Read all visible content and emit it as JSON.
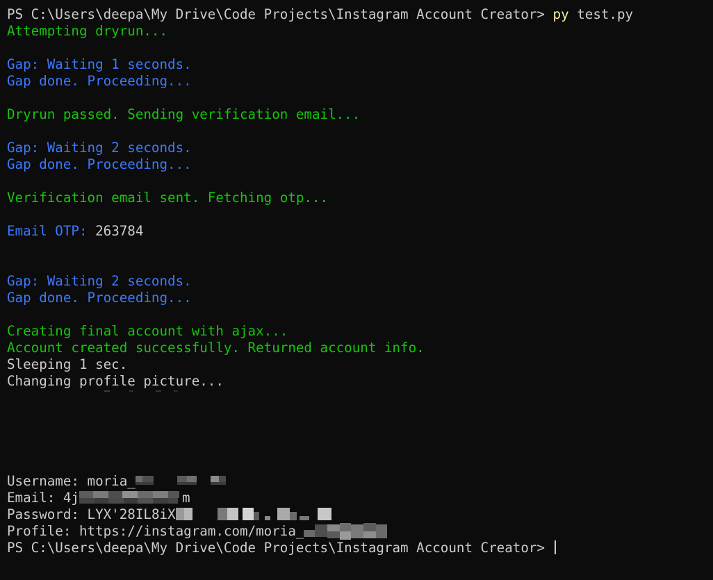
{
  "terminal": {
    "prompt": "PS C:\\Users\\deepa\\My Drive\\Code Projects\\Instagram Account Creator>",
    "command_exe": "py",
    "command_args": "test.py",
    "lines": {
      "l1": "Attempting dryrun...",
      "l2": "Gap: Waiting 1 seconds.",
      "l3": "Gap done. Proceeding...",
      "l4": "Dryrun passed. Sending verification email...",
      "l5": "Gap: Waiting 2 seconds.",
      "l6": "Gap done. Proceeding...",
      "l7": "Verification email sent. Fetching otp...",
      "l8_label": "Email OTP:",
      "l8_value": "263784",
      "l9": "Gap: Waiting 2 seconds.",
      "l10": "Gap done. Proceeding...",
      "l11": "Creating final account with ajax...",
      "l12": "Account created successfully. Returned account info.",
      "l13": "Sleeping 1 sec.",
      "l14": "Changing profile picture..."
    },
    "account": {
      "username_label": "Username:",
      "username_value": "moria_",
      "email_label": "Email:",
      "email_value": "4j",
      "email_tail": "m",
      "password_label": "Password:",
      "password_value": "LYX'28IL8iX",
      "profile_label": "Profile:",
      "profile_value": "https://instagram.com/moria_"
    },
    "final_prompt": "PS C:\\Users\\deepa\\My Drive\\Code Projects\\Instagram Account Creator>"
  },
  "colors": {
    "background": "#0c0c0c",
    "default_text": "#cccccc",
    "success_green": "#16c60c",
    "info_blue": "#3b78ff",
    "command_yellow": "#f9f1a5"
  }
}
